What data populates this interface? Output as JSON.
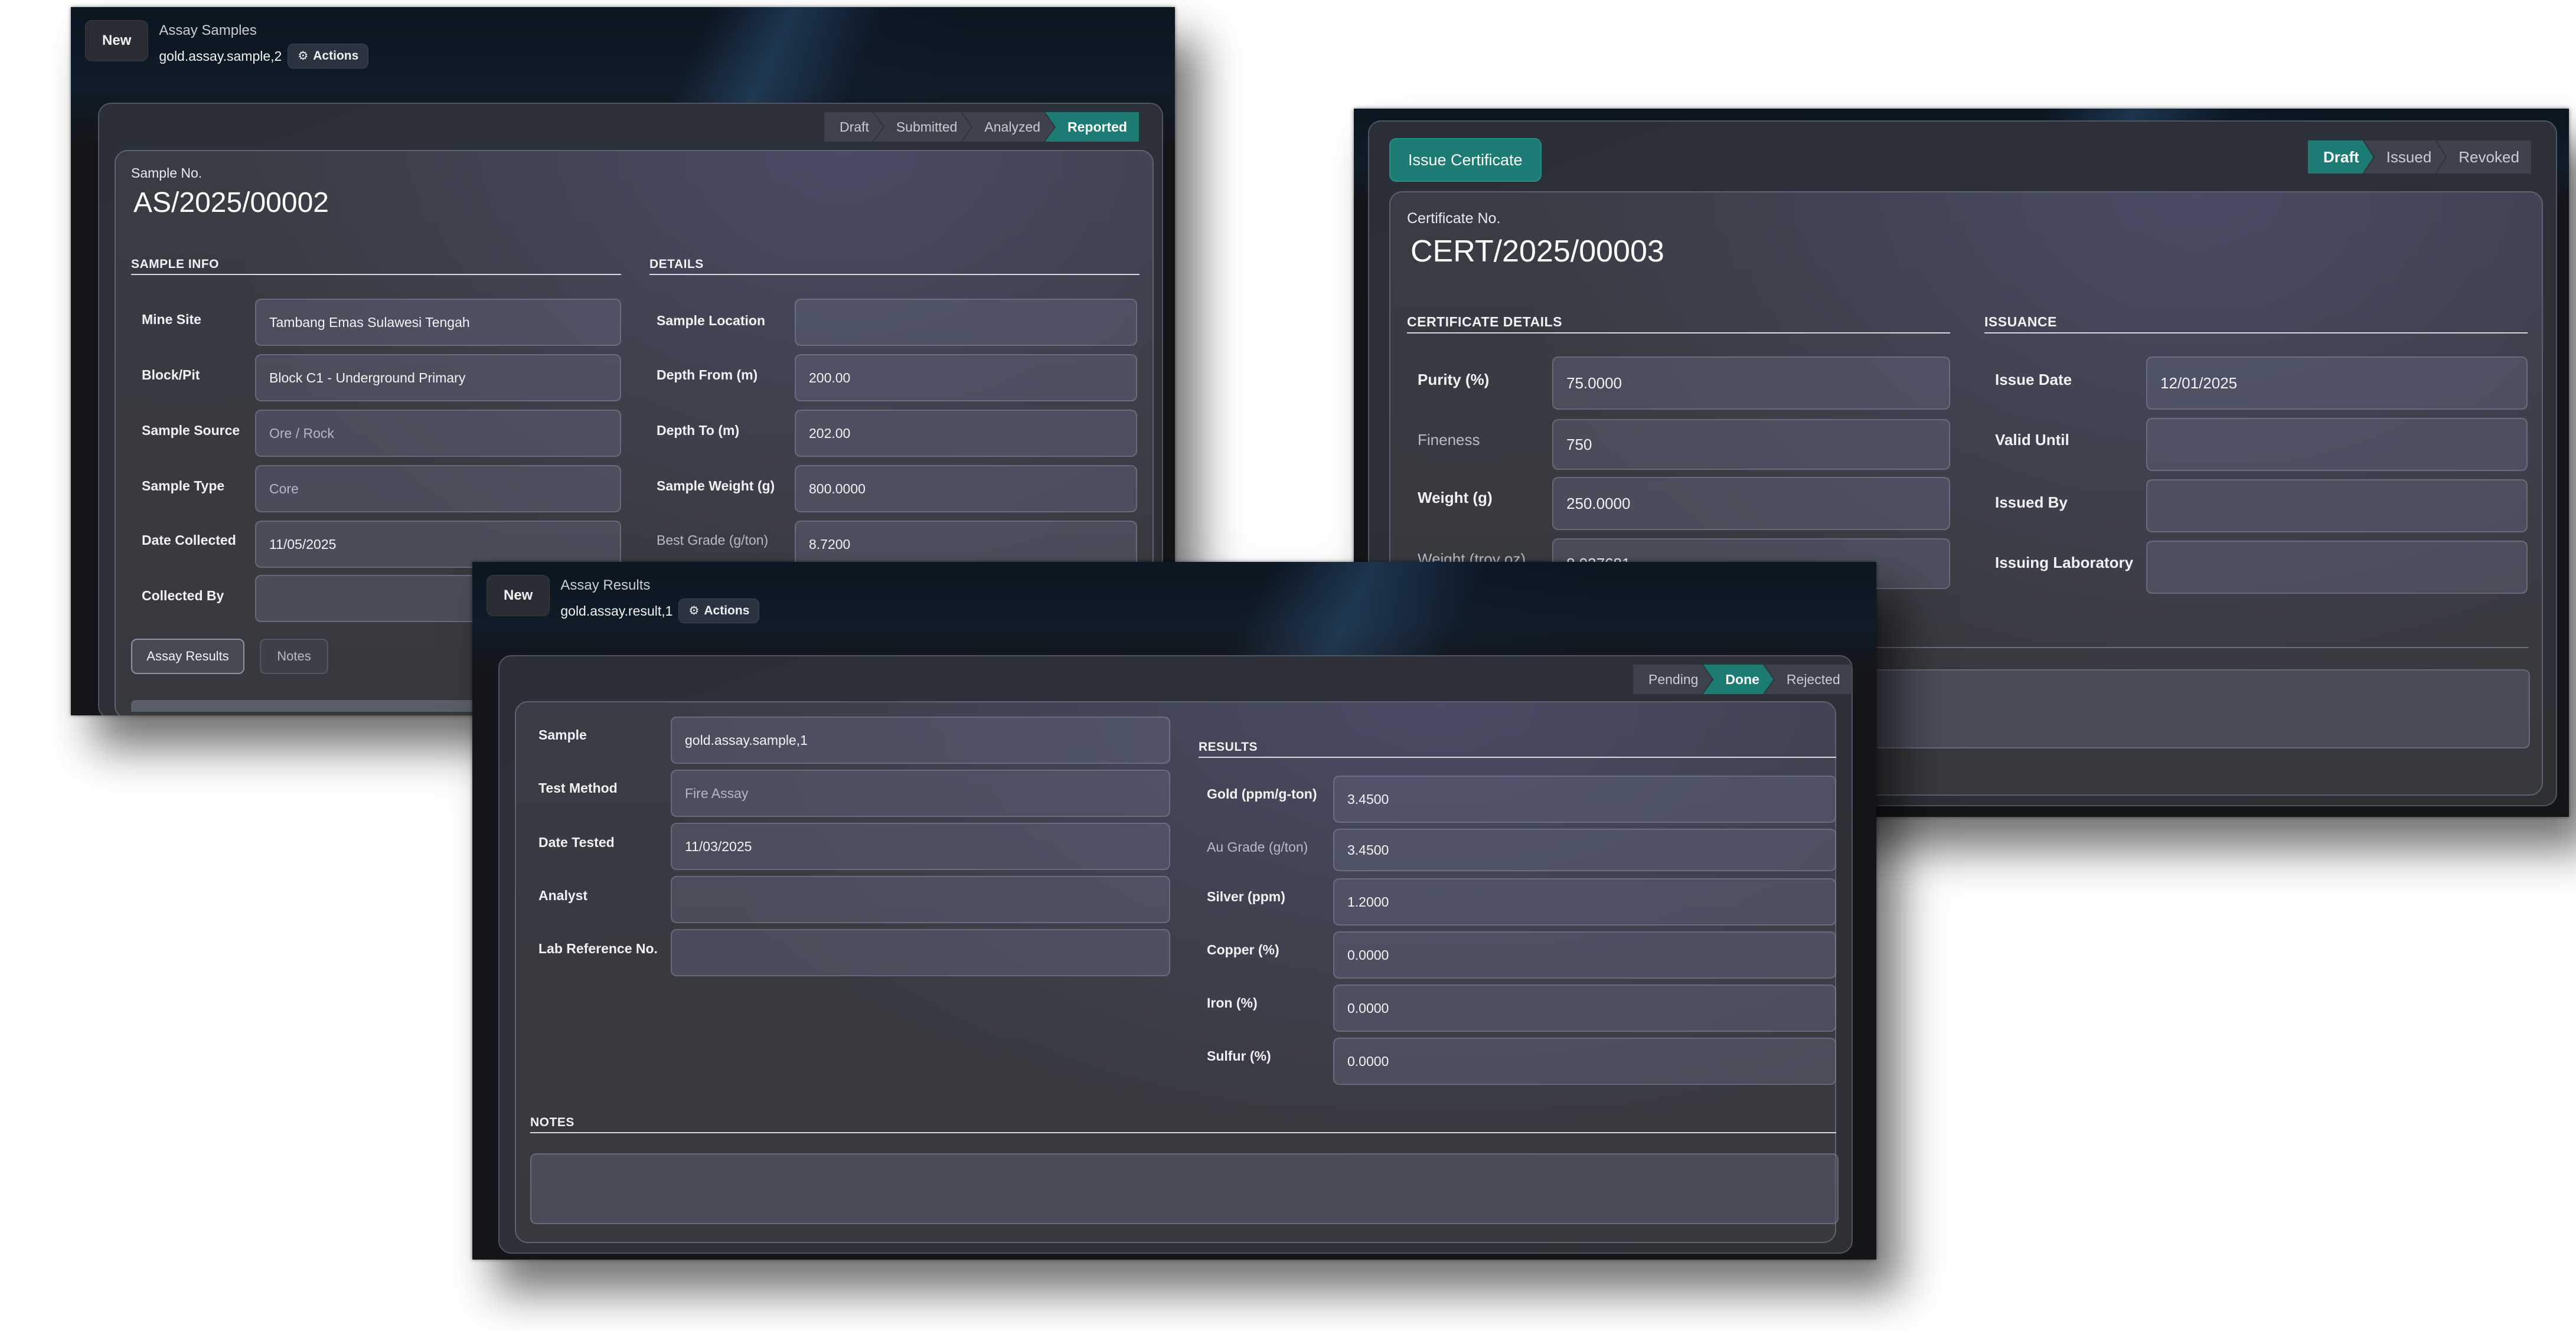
{
  "assay_samples": {
    "new_label": "New",
    "title": "Assay Samples",
    "record": "gold.assay.sample,2",
    "actions_label": "Actions",
    "statuses": [
      "Draft",
      "Submitted",
      "Analyzed",
      "Reported"
    ],
    "active_status": "Reported",
    "sample_no_label": "Sample No.",
    "sample_no": "AS/2025/00002",
    "sample_info_title": "SAMPLE INFO",
    "details_title": "DETAILS",
    "left_fields": [
      {
        "label": "Mine Site",
        "value": "Tambang Emas Sulawesi Tengah"
      },
      {
        "label": "Block/Pit",
        "value": "Block C1 - Underground Primary"
      },
      {
        "label": "Sample Source",
        "value": "Ore / Rock"
      },
      {
        "label": "Sample Type",
        "value": "Core"
      },
      {
        "label": "Date Collected",
        "value": "11/05/2025"
      },
      {
        "label": "Collected By",
        "value": ""
      }
    ],
    "right_fields": [
      {
        "label": "Sample Location",
        "value": ""
      },
      {
        "label": "Depth From (m)",
        "value": "200.00"
      },
      {
        "label": "Depth To (m)",
        "value": "202.00"
      },
      {
        "label": "Sample Weight (g)",
        "value": "800.0000"
      },
      {
        "label": "Best Grade (g/ton)",
        "value": "8.7200"
      }
    ],
    "tabs": [
      "Assay Results",
      "Notes"
    ]
  },
  "certificate": {
    "issue_label": "Issue Certificate",
    "statuses": [
      "Draft",
      "Issued",
      "Revoked"
    ],
    "active_status": "Draft",
    "cert_no_label": "Certificate No.",
    "cert_no": "CERT/2025/00003",
    "details_title": "CERTIFICATE DETAILS",
    "issuance_title": "ISSUANCE",
    "left_fields": [
      {
        "label": "Purity (%)",
        "value": "75.0000"
      },
      {
        "label": "Fineness",
        "value": "750"
      },
      {
        "label": "Weight (g)",
        "value": "250.0000"
      },
      {
        "label": "Weight (troy oz)",
        "value": "8.037681"
      }
    ],
    "right_fields": [
      {
        "label": "Issue Date",
        "value": "12/01/2025"
      },
      {
        "label": "Valid Until",
        "value": ""
      },
      {
        "label": "Issued By",
        "value": ""
      },
      {
        "label": "Issuing Laboratory",
        "value": ""
      }
    ]
  },
  "assay_results": {
    "new_label": "New",
    "title": "Assay Results",
    "record": "gold.assay.result,1",
    "actions_label": "Actions",
    "statuses": [
      "Pending",
      "Done",
      "Rejected"
    ],
    "active_status": "Done",
    "left_fields": [
      {
        "label": "Sample",
        "value": "gold.assay.sample,1"
      },
      {
        "label": "Test Method",
        "value": "Fire Assay"
      },
      {
        "label": "Date Tested",
        "value": "11/03/2025"
      },
      {
        "label": "Analyst",
        "value": ""
      },
      {
        "label": "Lab Reference No.",
        "value": ""
      }
    ],
    "results_title": "RESULTS",
    "right_fields": [
      {
        "label": "Gold (ppm/g-ton)",
        "value": "3.4500"
      },
      {
        "label": "Au Grade (g/ton)",
        "value": "3.4500"
      },
      {
        "label": "Silver (ppm)",
        "value": "1.2000"
      },
      {
        "label": "Copper (%)",
        "value": "0.0000"
      },
      {
        "label": "Iron (%)",
        "value": "0.0000"
      },
      {
        "label": "Sulfur (%)",
        "value": "0.0000"
      }
    ],
    "notes_title": "NOTES",
    "notes_value": ""
  }
}
